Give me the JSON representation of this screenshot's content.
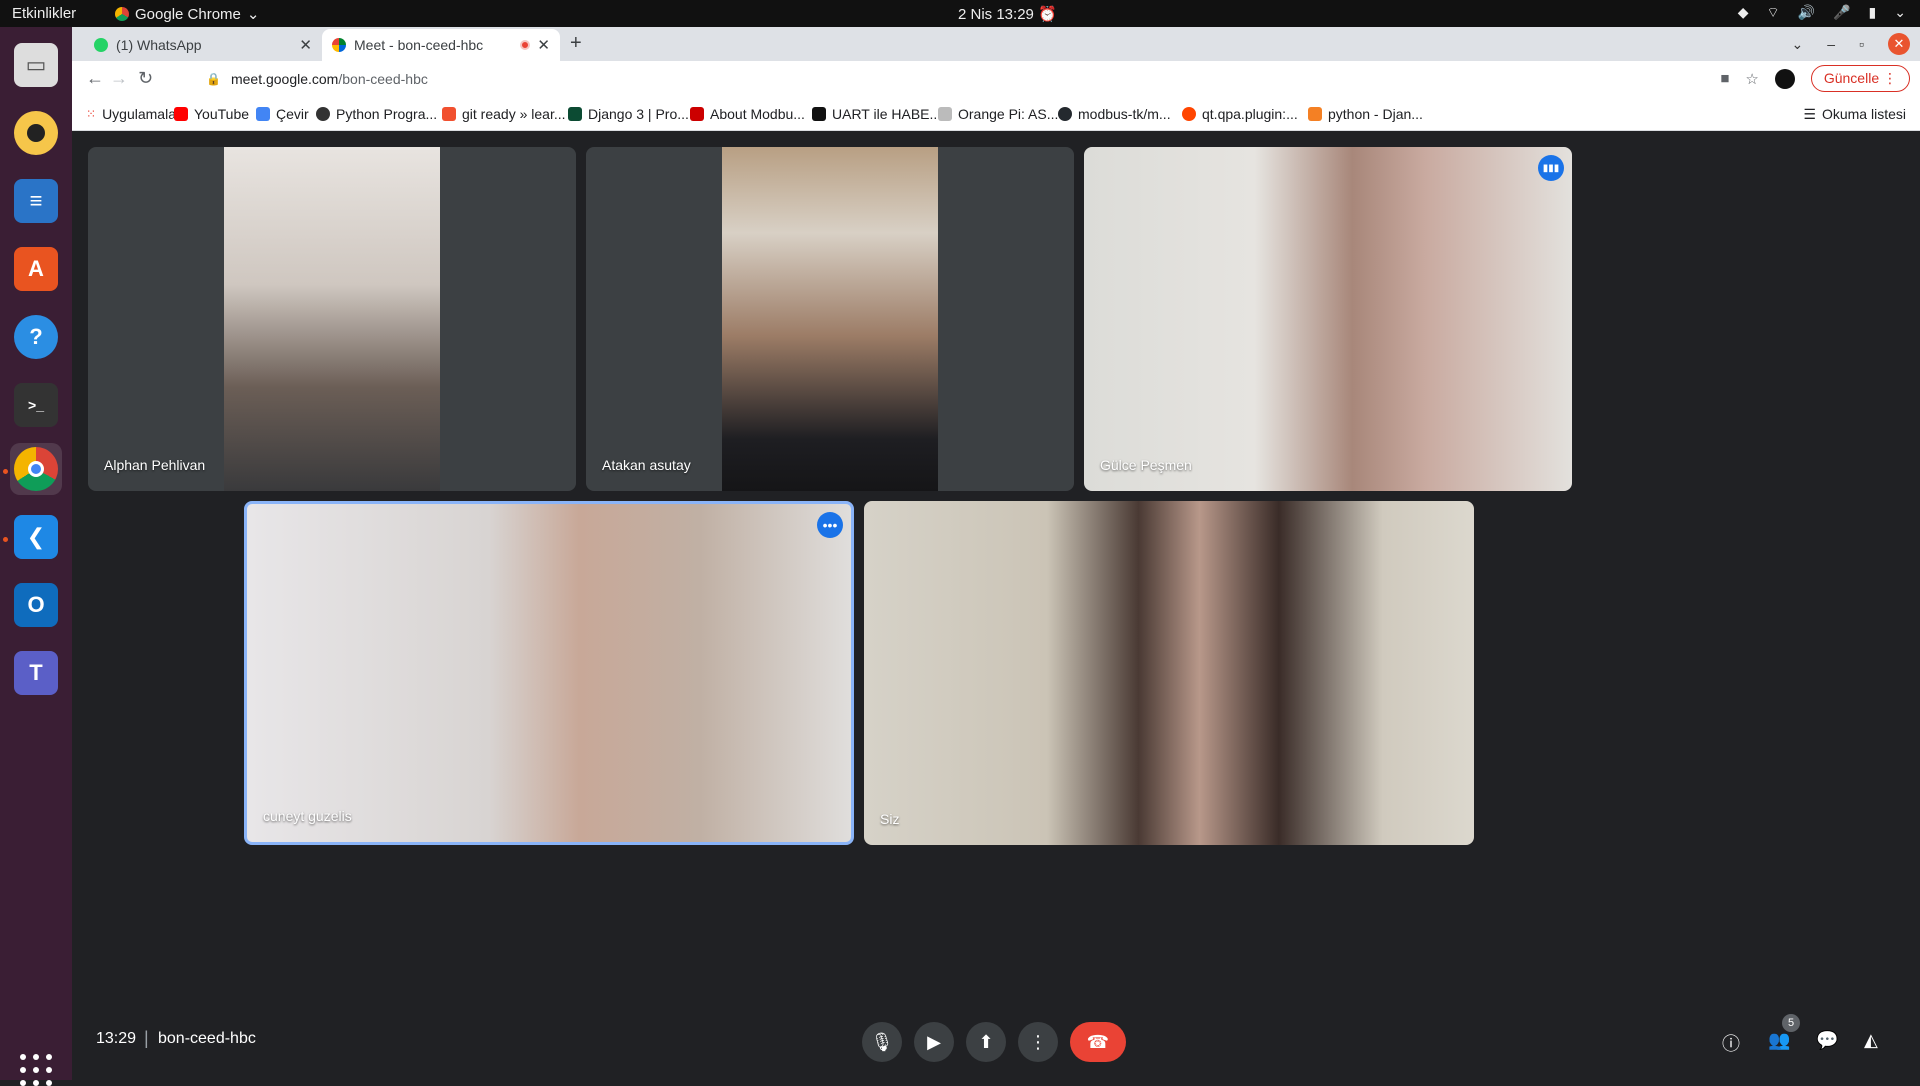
{
  "system_bar": {
    "activities": "Etkinlikler",
    "app_name": "Google Chrome",
    "clock": "2 Nis  13:29"
  },
  "dock": {
    "items": [
      "files",
      "rhythmbox",
      "writer",
      "software-center",
      "help",
      "terminal",
      "chrome",
      "vscode",
      "outlook",
      "teams"
    ]
  },
  "browser": {
    "tabs": [
      {
        "title": "(1) WhatsApp"
      },
      {
        "title": "Meet - bon-ceed-hbc"
      }
    ],
    "url_host": "meet.google.com",
    "url_path": "/bon-ceed-hbc",
    "update_button": "Güncelle",
    "bookmarks": [
      "Uygulamalar",
      "YouTube",
      "Çevir",
      "Python Progra...",
      "git ready » lear...",
      "Django 3 | Pro...",
      "About Modbu...",
      "UART ile HABE...",
      "Orange Pi: AS...",
      "modbus-tk/m...",
      "qt.qpa.plugin:...",
      "python - Djan..."
    ],
    "reading_list": "Okuma listesi"
  },
  "meet": {
    "participants": [
      {
        "name": "Alphan Pehlivan"
      },
      {
        "name": "Atakan asutay"
      },
      {
        "name": "Gülce Peşmen"
      },
      {
        "name": "cuneyt guzelis"
      },
      {
        "name": "Siz"
      }
    ],
    "time": "13:29",
    "separator": "|",
    "meeting_code": "bon-ceed-hbc",
    "participant_count": "5"
  },
  "colors": {
    "meet_bg": "#202124",
    "tile_bg": "#3c4043",
    "end_call": "#ea4335",
    "selected_border": "#8ab4f8",
    "accent_blue": "#1a73e8"
  }
}
